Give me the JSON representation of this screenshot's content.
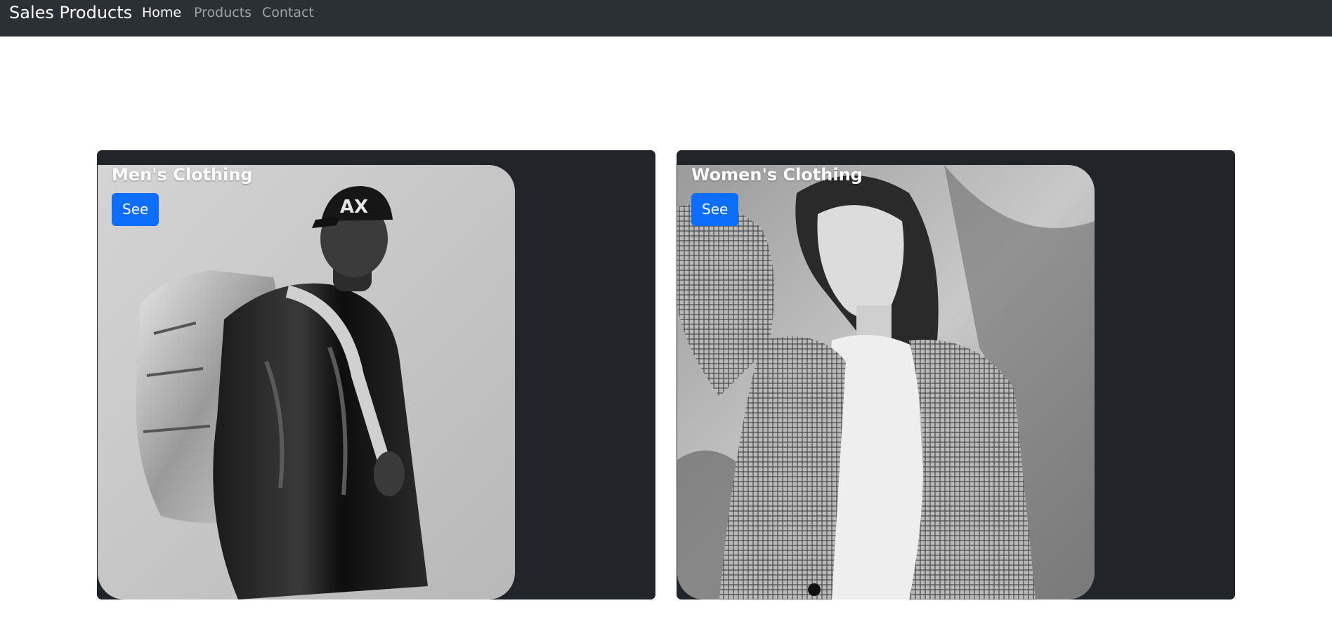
{
  "navbar": {
    "brand": "Sales Products",
    "links": [
      {
        "label": "Home",
        "active": true
      },
      {
        "label": "Products",
        "active": false
      },
      {
        "label": "Contact",
        "active": false
      }
    ]
  },
  "categories": [
    {
      "title": "Men's Clothing",
      "button_label": "See"
    },
    {
      "title": "Women's Clothing",
      "button_label": "See"
    }
  ],
  "colors": {
    "navbar_bg": "#2b3035",
    "card_bg": "#212529",
    "button_primary": "#0d6efd"
  }
}
